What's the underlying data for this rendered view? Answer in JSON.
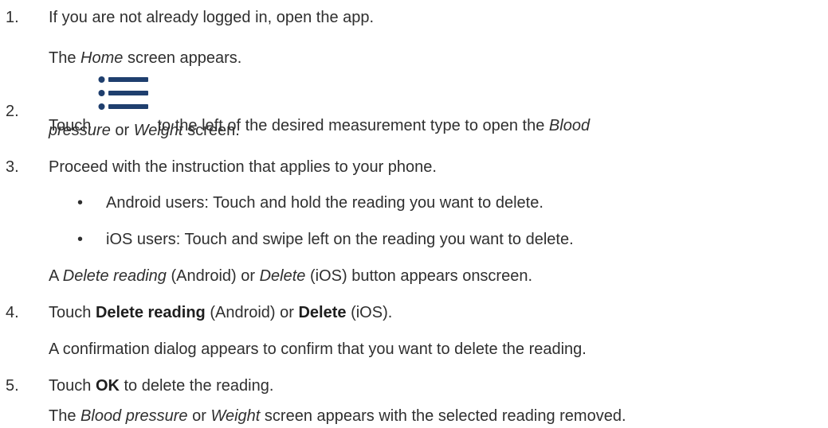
{
  "steps": [
    {
      "number": "1.",
      "text": "If you are not already logged in, open the app.",
      "note": {
        "prefix": "The ",
        "home": "Home",
        "suffix": " screen appears."
      }
    },
    {
      "number": "2.",
      "prefix": "Touch ",
      "icon": "menu-list-icon",
      "mid": " to the left of the desired measurement type to open the ",
      "blood_pressure": "Blood",
      "pressure": "pressure",
      "or": " or ",
      "weight": "Weight",
      "suffix": " screen."
    },
    {
      "number": "3.",
      "text": "Proceed with the instruction that applies to your phone.",
      "bullets": [
        "Android users: Touch and hold the reading you want to delete.",
        "iOS users: Touch and swipe left on the reading you want to delete."
      ],
      "note": {
        "prefix": "A ",
        "delete_reading": "Delete reading",
        "android": " (Android) or ",
        "delete": "Delete",
        "suffix": " (iOS) button appears onscreen."
      }
    },
    {
      "number": "4.",
      "prefix": "Touch ",
      "delete_reading": "Delete reading",
      "android": " (Android) or ",
      "delete": "Delete",
      "suffix": " (iOS).",
      "note": "A confirmation dialog appears to confirm that you want to delete the reading."
    },
    {
      "number": "5.",
      "prefix": "Touch ",
      "ok": "OK",
      "suffix": " to delete the reading.",
      "note": {
        "prefix": "The ",
        "blood_pressure": "Blood pressure",
        "or": " or ",
        "weight": "Weight",
        "suffix": " screen appears with the selected reading removed."
      }
    }
  ],
  "colors": {
    "text": "#2f2f2f",
    "icon": "#1f3f6e"
  }
}
